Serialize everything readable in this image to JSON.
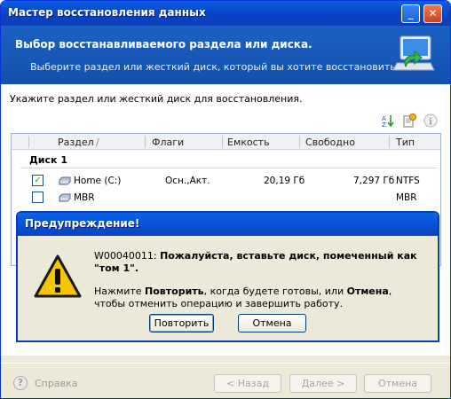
{
  "window": {
    "title": "Мастер восстановления данных",
    "minimize_glyph": "_",
    "close_glyph": "✕"
  },
  "header": {
    "title": "Выбор восстанавливаемого раздела или диска.",
    "subtitle": "Выберите раздел или жесткий диск, который вы хотите восстановить.",
    "icon": "monitor-restore-icon"
  },
  "content": {
    "instruction": "Укажите раздел или жесткий диск для восстановления.",
    "toolbar_icons": [
      "sort-icon",
      "properties-icon",
      "info-icon"
    ]
  },
  "table": {
    "columns": [
      "Раздел",
      "Флаги",
      "Емкость",
      "Свободно",
      "Тип"
    ],
    "sort_indicator": "/",
    "disk_label": "Диск 1",
    "rows": [
      {
        "checked": true,
        "partition": "Home (C:)",
        "flags": "Осн.,Акт.",
        "capacity": "20,19 Гб",
        "free": "7,297 Гб",
        "type": "NTFS"
      },
      {
        "checked": false,
        "partition": "MBR",
        "flags": "",
        "capacity": "",
        "free": "",
        "type": "MBR"
      }
    ]
  },
  "dialog": {
    "title": "Предупреждение!",
    "code": "W00040011: ",
    "message_bold": "Пожалуйста, вставьте диск, помеченный как \"том 1\".",
    "line2_a": "Нажмите ",
    "line2_retry": "Повторить",
    "line2_b": ", когда будете готовы, или ",
    "line2_cancel": "Отмена",
    "line2_c": ", чтобы отменить операцию и завершить работу.",
    "retry_button": "Повторить",
    "cancel_button": "Отмена"
  },
  "footer": {
    "help": "Справка",
    "back": "< Назад",
    "next": "Далее >",
    "cancel": "Отмена"
  }
}
